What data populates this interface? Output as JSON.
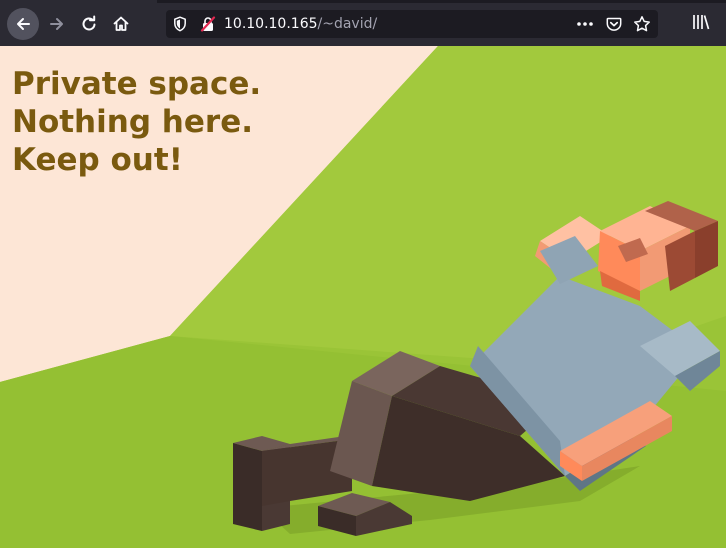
{
  "browser": {
    "url_host": "10.10.10.165",
    "url_path": "/~david/",
    "icons": {
      "back": "back-arrow-icon",
      "forward": "forward-arrow-icon",
      "reload": "reload-icon",
      "home": "home-icon",
      "tracking": "tracking-shield-icon",
      "insecure": "insecure-connection-icon",
      "more": "more-options-icon",
      "pocket": "pocket-icon",
      "bookmark": "bookmark-star-icon",
      "library": "library-icon"
    }
  },
  "page": {
    "headline": [
      "Private space.",
      "Nothing here.",
      "Keep out!"
    ],
    "colors": {
      "headline": "#7a5a0f",
      "lawn": "#9ac437",
      "wall": "#fde6d6"
    }
  }
}
